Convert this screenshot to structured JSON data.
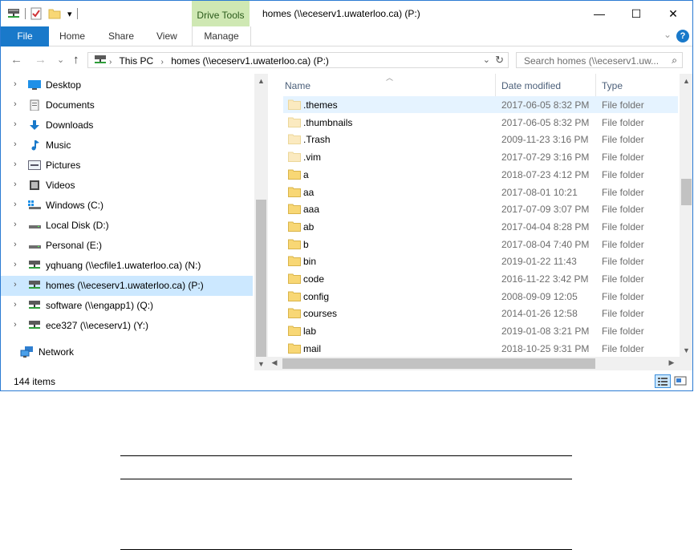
{
  "window": {
    "context_tab": "Drive Tools",
    "title": "homes (\\\\eceserv1.uwaterloo.ca) (P:)",
    "minimize": "—",
    "maximize": "☐",
    "close": "✕"
  },
  "ribbon": {
    "tabs": [
      "File",
      "Home",
      "Share",
      "View",
      "Manage"
    ],
    "collapse": "⌄",
    "help": "?"
  },
  "address": {
    "back": "←",
    "forward": "→",
    "recent": "⌄",
    "up": "↑",
    "crumbs": [
      "This PC",
      "homes (\\\\eceserv1.uwaterloo.ca) (P:)"
    ],
    "crumb_sep": "›",
    "dropdown": "⌄",
    "refresh": "↻",
    "search_placeholder": "Search homes (\\\\eceserv1.uw...",
    "search_icon": "⌕"
  },
  "nav": {
    "items": [
      {
        "label": "Desktop",
        "icon": "desktop-icon"
      },
      {
        "label": "Documents",
        "icon": "documents-icon"
      },
      {
        "label": "Downloads",
        "icon": "downloads-icon"
      },
      {
        "label": "Music",
        "icon": "music-icon"
      },
      {
        "label": "Pictures",
        "icon": "pictures-icon"
      },
      {
        "label": "Videos",
        "icon": "videos-icon"
      },
      {
        "label": "Windows (C:)",
        "icon": "windows-drive-icon"
      },
      {
        "label": "Local Disk (D:)",
        "icon": "drive-icon"
      },
      {
        "label": "Personal (E:)",
        "icon": "drive-icon"
      },
      {
        "label": "yqhuang (\\\\ecfile1.uwaterloo.ca) (N:)",
        "icon": "network-drive-icon"
      },
      {
        "label": "homes (\\\\eceserv1.uwaterloo.ca) (P:)",
        "icon": "network-drive-icon",
        "selected": true
      },
      {
        "label": "software (\\\\engapp1) (Q:)",
        "icon": "network-drive-icon"
      },
      {
        "label": "ece327 (\\\\eceserv1) (Y:)",
        "icon": "network-drive-icon"
      }
    ],
    "network": "Network",
    "expand_glyph": "›"
  },
  "list": {
    "columns": {
      "name": "Name",
      "date": "Date modified",
      "type": "Type"
    },
    "rows": [
      {
        "name": ".themes",
        "date": "2017-06-05 8:32 PM",
        "type": "File folder",
        "hidden": true,
        "selected": true
      },
      {
        "name": ".thumbnails",
        "date": "2017-06-05 8:32 PM",
        "type": "File folder",
        "hidden": true
      },
      {
        "name": ".Trash",
        "date": "2009-11-23 3:16 PM",
        "type": "File folder",
        "hidden": true
      },
      {
        "name": ".vim",
        "date": "2017-07-29 3:16 PM",
        "type": "File folder",
        "hidden": true
      },
      {
        "name": "a",
        "date": "2018-07-23 4:12 PM",
        "type": "File folder"
      },
      {
        "name": "aa",
        "date": "2017-08-01 10:21",
        "type": "File folder"
      },
      {
        "name": "aaa",
        "date": "2017-07-09 3:07 PM",
        "type": "File folder"
      },
      {
        "name": "ab",
        "date": "2017-04-04 8:28 PM",
        "type": "File folder"
      },
      {
        "name": "b",
        "date": "2017-08-04 7:40 PM",
        "type": "File folder"
      },
      {
        "name": "bin",
        "date": "2019-01-22 11:43",
        "type": "File folder"
      },
      {
        "name": "code",
        "date": "2016-11-22 3:42 PM",
        "type": "File folder"
      },
      {
        "name": "config",
        "date": "2008-09-09 12:05",
        "type": "File folder"
      },
      {
        "name": "courses",
        "date": "2014-01-26 12:58",
        "type": "File folder"
      },
      {
        "name": "lab",
        "date": "2019-01-08 3:21 PM",
        "type": "File folder"
      },
      {
        "name": "mail",
        "date": "2018-10-25 9:31 PM",
        "type": "File folder"
      }
    ]
  },
  "status": {
    "item_count": "144 items"
  },
  "colors": {
    "accent": "#1979ca",
    "context_tab": "#cfe8b3",
    "selection": "#cce8ff",
    "folder": "#f8d775"
  }
}
